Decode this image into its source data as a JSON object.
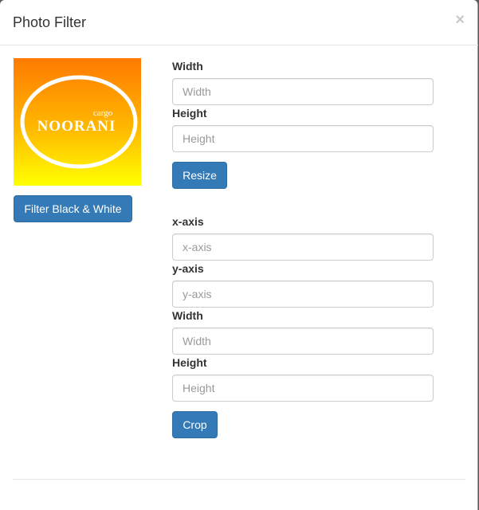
{
  "modal": {
    "title": "Photo Filter",
    "close_glyph": "×"
  },
  "logo": {
    "small_text": "cargo",
    "brand_text": "NOORANI"
  },
  "filter_button": "Filter Black & White",
  "resize": {
    "width_label": "Width",
    "width_placeholder": "Width",
    "height_label": "Height",
    "height_placeholder": "Height",
    "button": "Resize"
  },
  "crop": {
    "x_label": "x-axis",
    "x_placeholder": "x-axis",
    "y_label": "y-axis",
    "y_placeholder": "y-axis",
    "width_label": "Width",
    "width_placeholder": "Width",
    "height_label": "Height",
    "height_placeholder": "Height",
    "button": "Crop"
  },
  "colors": {
    "primary": "#337ab7",
    "logo_top": "#ff7a00",
    "logo_bottom": "#ffff00"
  }
}
